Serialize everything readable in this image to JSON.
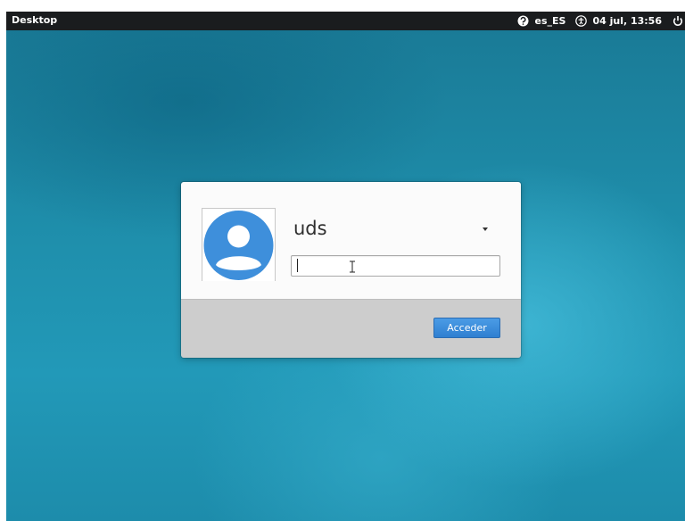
{
  "topbar": {
    "desktop_label": "Desktop",
    "locale": "es_ES",
    "clock": "04 jul, 13:56",
    "icons": [
      "help-circle-icon",
      "accessibility-icon",
      "power-icon"
    ]
  },
  "login": {
    "username": "uds",
    "password_value": "",
    "submit_label": "Acceder"
  },
  "colors": {
    "topbar_bg": "#1a1c1e",
    "desktop_bg": "#1f90ad",
    "button_accent": "#3a8ddc",
    "avatar_blue": "#3e8fdb"
  }
}
